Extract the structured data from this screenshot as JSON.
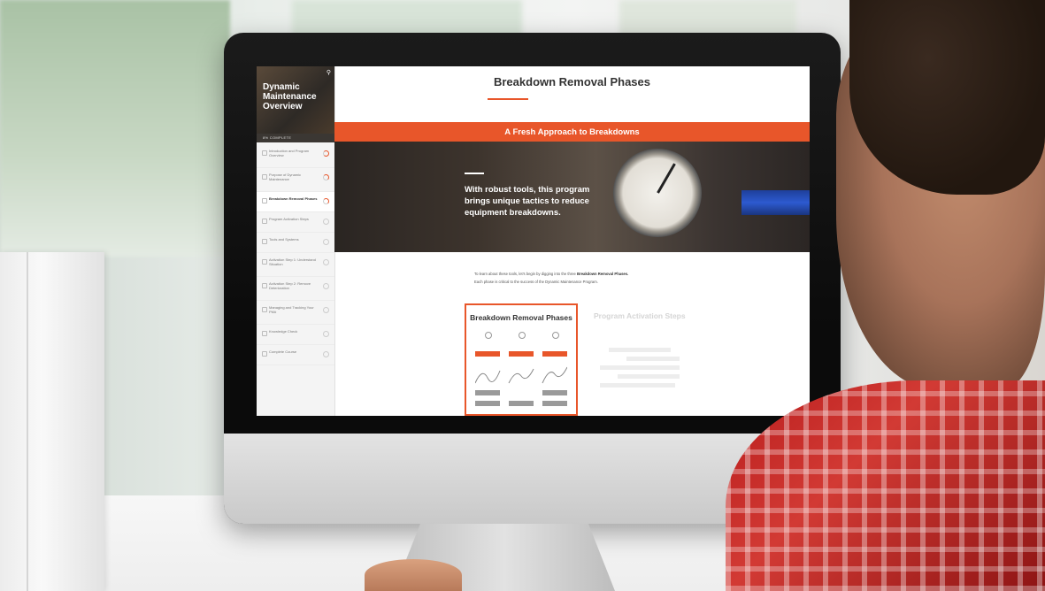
{
  "sidebar": {
    "course_title": "Dynamic Maintenance Overview",
    "progress_label": "8% COMPLETE",
    "search_icon": "search-icon",
    "items": [
      {
        "label": "Introduction and Program Overview",
        "status": "partial"
      },
      {
        "label": "Purpose of Dynamic Maintenance",
        "status": "partial"
      },
      {
        "label": "Breakdown Removal Phases",
        "status": "partial",
        "active": true
      },
      {
        "label": "Program Activation Steps",
        "status": "empty"
      },
      {
        "label": "Tools and Systems",
        "status": "empty"
      },
      {
        "label": "Activation Step 1: Understand Situation",
        "status": "empty"
      },
      {
        "label": "Activation Step 2: Remove Deterioration",
        "status": "empty"
      },
      {
        "label": "Managing and Tracking Your PM#",
        "status": "empty"
      },
      {
        "label": "Knowledge Check",
        "status": "empty"
      },
      {
        "label": "Complete Course",
        "status": "empty"
      }
    ]
  },
  "main": {
    "page_title": "Breakdown Removal Phases",
    "banner": "A Fresh Approach to Breakdowns",
    "hero_text": "With robust tools, this program brings unique tactics to reduce equipment breakdowns.",
    "intro_line1_start": "To learn about these tools, let's begin by digging into the three ",
    "intro_line1_bold": "Breakdown Removal Phases.",
    "intro_line2": "Each phase is critical to the success of the Dynamic Maintenance Program.",
    "cards": [
      {
        "title": "Breakdown Removal Phases",
        "selected": true
      },
      {
        "title": "Program Activation Steps",
        "selected": false
      }
    ]
  },
  "colors": {
    "accent": "#e8562a",
    "sidebar_bg": "#f4f4f4",
    "title_text": "#333333"
  }
}
